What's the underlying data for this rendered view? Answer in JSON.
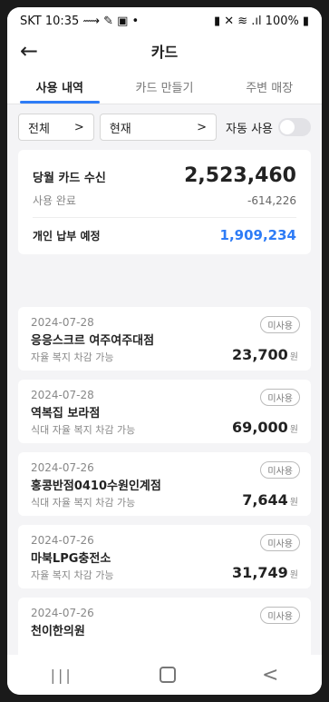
{
  "status": {
    "time": "SKT 10:35",
    "battery": "100%"
  },
  "header": {
    "title": "카드",
    "back_icon": "←"
  },
  "tabs": [
    "사용 내역",
    "카드 만들기",
    "주변 매장"
  ],
  "filters": {
    "category": "전체",
    "period": "현재",
    "auto_use_label": "자동 사용"
  },
  "summary": {
    "title": "당월 카드 수신",
    "total": "2,523,460",
    "used_label": "사용 완료",
    "used": "-614,226",
    "pay_label": "개인 납부 예정",
    "pay": "1,909,234"
  },
  "transactions": [
    {
      "date": "2024-07-28",
      "merchant": "응응스크르 여주여주대점",
      "benefit": "자율 복지 차감 가능",
      "amount": "23,700",
      "unit": "원",
      "badge": "미사용"
    },
    {
      "date": "2024-07-28",
      "merchant": "역복집 보라점",
      "benefit": "식대 자율 복지 차감 가능",
      "amount": "69,000",
      "unit": "원",
      "badge": "미사용"
    },
    {
      "date": "2024-07-26",
      "merchant": "홍콩반점0410수원인계점",
      "benefit": "식대 자율 복지 차감 가능",
      "amount": "7,644",
      "unit": "원",
      "badge": "미사용"
    },
    {
      "date": "2024-07-26",
      "merchant": "마북LPG충전소",
      "benefit": "자율 복지 차감 가능",
      "amount": "31,749",
      "unit": "원",
      "badge": "미사용"
    },
    {
      "date": "2024-07-26",
      "merchant": "천이한의원",
      "benefit": "",
      "amount": "",
      "unit": "",
      "badge": "미사용"
    }
  ],
  "navbar": {
    "recent": "|||",
    "back": "<"
  },
  "colors": {
    "accent": "#2e7cf6"
  }
}
